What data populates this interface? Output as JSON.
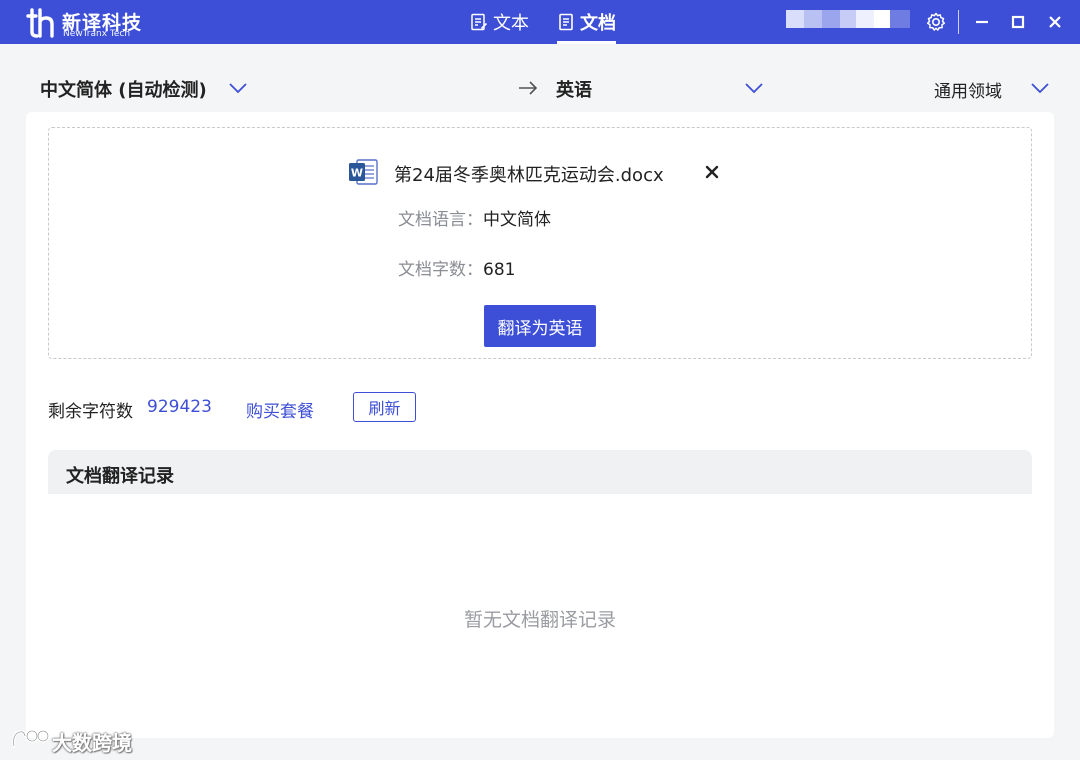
{
  "app": {
    "logo_cn": "新译科技",
    "logo_en": "NewTranx Tech"
  },
  "nav": {
    "tabs": [
      {
        "label": "文本",
        "active": false,
        "icon": "text-document-icon"
      },
      {
        "label": "文档",
        "active": true,
        "icon": "document-icon"
      }
    ]
  },
  "window_controls": [
    "settings-gear-icon",
    "minimize-icon",
    "maximize-icon",
    "close-icon"
  ],
  "language_bar": {
    "source": "中文简体 (自动检测)",
    "target": "英语",
    "domain": "通用领域"
  },
  "upload": {
    "file_name": "第24届冬季奥林匹克运动会.docx",
    "doc_language_label": "文档语言：",
    "doc_language_value": "中文简体",
    "word_count_label": "文档字数：",
    "word_count_value": "681",
    "translate_button": "翻译为英语"
  },
  "quota": {
    "label": "剩余字符数",
    "value": "929423",
    "buy_link": "购买套餐",
    "refresh_button": "刷新"
  },
  "history": {
    "title": "文档翻译记录",
    "empty_message": "暂无文档翻译记录"
  },
  "watermark": {
    "text": "大数跨境"
  },
  "colors": {
    "primary": "#3d4fd6",
    "background": "#f4f5f7",
    "card": "#ffffff",
    "muted_text": "#8a8d93",
    "empty_text": "#9a9ca1"
  }
}
